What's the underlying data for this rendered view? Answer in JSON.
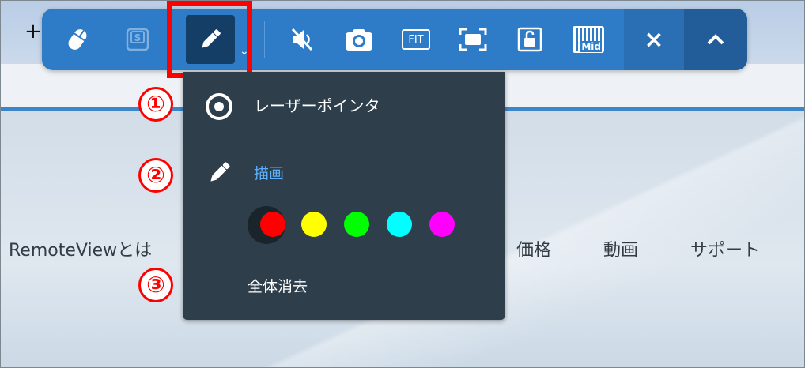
{
  "browser": {
    "new_tab_symbol": "+"
  },
  "page_nav": {
    "about": "RemoteViewとは",
    "price": "価格",
    "video": "動画",
    "support": "サポート"
  },
  "toolbar": {
    "buttons": [
      {
        "id": "mouse",
        "icon": "mouse-icon"
      },
      {
        "id": "keyboard-s",
        "icon": "keyboard-s-icon",
        "state": "disabled"
      },
      {
        "id": "pen",
        "icon": "pen-icon",
        "state": "active"
      },
      {
        "id": "mute",
        "icon": "speaker-muted-icon"
      },
      {
        "id": "screenshot",
        "icon": "camera-icon"
      },
      {
        "id": "fit",
        "icon": "fit-icon",
        "label": "FIT"
      },
      {
        "id": "fullscreen",
        "icon": "fullscreen-icon"
      },
      {
        "id": "lock",
        "icon": "unlock-icon"
      },
      {
        "id": "mid",
        "icon": "keyboard-mid-icon",
        "label": "Mid"
      },
      {
        "id": "close",
        "icon": "close-icon"
      },
      {
        "id": "collapse",
        "icon": "chevron-up-icon"
      }
    ],
    "fit_label": "FIT",
    "mid_label": "Mid",
    "close_symbol": "×"
  },
  "menu": {
    "laser_label": "レーザーポインタ",
    "draw_label": "描画",
    "clear_all_label": "全体消去",
    "colors": [
      "#ff0000",
      "#ffff00",
      "#00ff00",
      "#00ffff",
      "#ff00ff"
    ],
    "selected_color": "#ff0000"
  },
  "annotations": {
    "one": "①",
    "two": "②",
    "three": "③",
    "highlight_color": "#ff0000"
  }
}
